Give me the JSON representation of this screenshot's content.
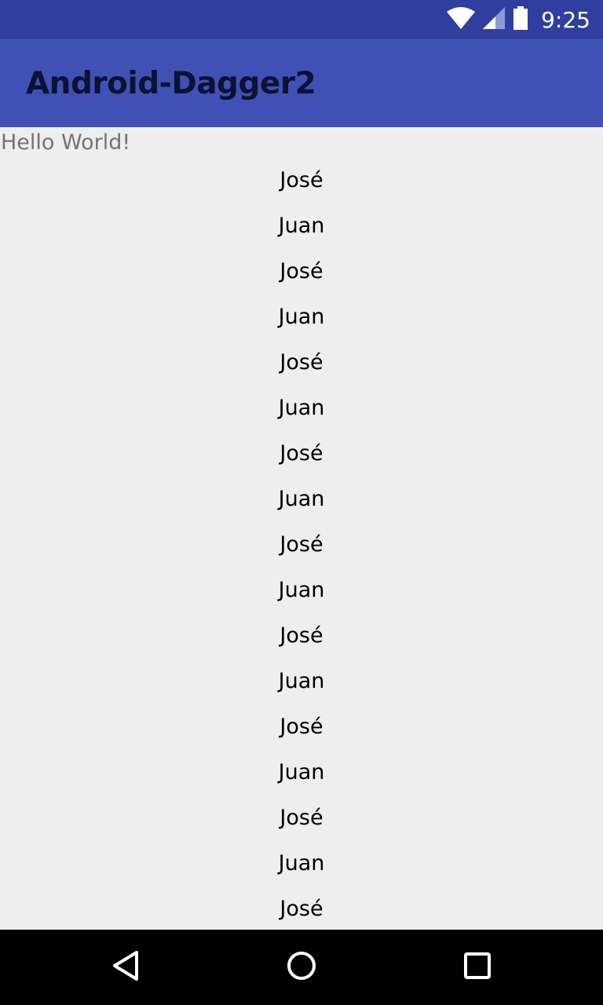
{
  "status_bar": {
    "time": "9:25",
    "icons": [
      "wifi-icon",
      "signal-icon",
      "battery-icon"
    ],
    "color": "#303f9f"
  },
  "app_bar": {
    "title": "Android-Dagger2",
    "color": "#3f51b5"
  },
  "content": {
    "hello_text": "Hello World!",
    "names": [
      "José",
      "Juan",
      "José",
      "Juan",
      "José",
      "Juan",
      "José",
      "Juan",
      "José",
      "Juan",
      "José",
      "Juan",
      "José",
      "Juan",
      "José",
      "Juan",
      "José"
    ]
  },
  "nav_bar": {
    "buttons": [
      "back-icon",
      "home-icon",
      "recents-icon"
    ]
  }
}
